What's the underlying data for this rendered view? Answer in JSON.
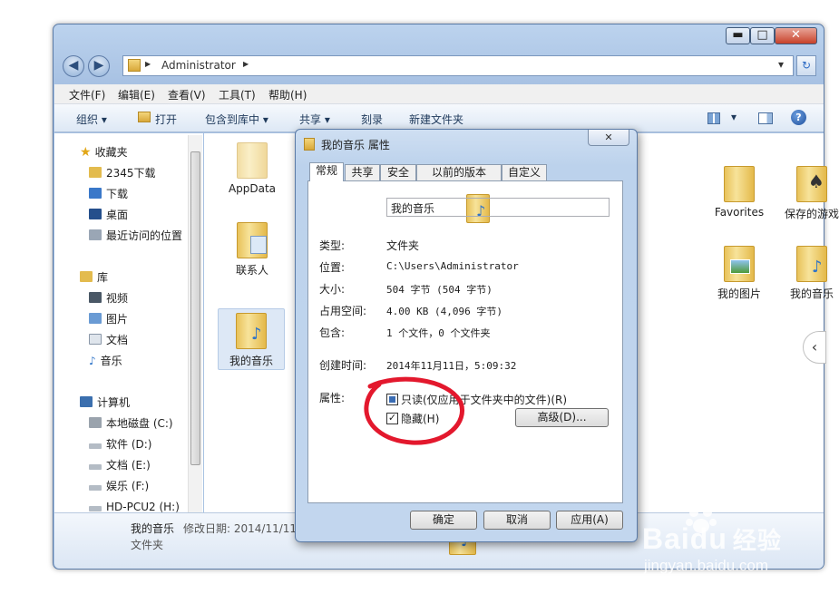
{
  "window": {
    "min": "▬",
    "max": "□",
    "close": "✕",
    "back": "◀",
    "forward": "▶",
    "breadcrumb": "Administrator",
    "breadcrumb_arrow": "▶",
    "dropdown": "▾",
    "refresh": "↻"
  },
  "menu": [
    "文件(F)",
    "编辑(E)",
    "查看(V)",
    "工具(T)",
    "帮助(H)"
  ],
  "toolbar": {
    "organize": "组织 ▾",
    "open": "打开",
    "include": "包含到库中 ▾",
    "share": "共享 ▾",
    "burn": "刻录",
    "new_folder": "新建文件夹",
    "help": "?"
  },
  "nav": {
    "favorites": "收藏夹",
    "fav_items": [
      "2345下载",
      "下载",
      "桌面",
      "最近访问的位置"
    ],
    "library": "库",
    "lib_items": [
      "视频",
      "图片",
      "文档",
      "音乐"
    ],
    "computer": "计算机",
    "drives": [
      "本地磁盘 (C:)",
      "软件 (D:)",
      "文档 (E:)",
      "娱乐 (F:)",
      "HD-PCU2 (H:)"
    ]
  },
  "content": {
    "items": [
      "AppData",
      "联系人",
      "我的音乐",
      "Favorites",
      "保存的游戏",
      "我的图片",
      "我的音乐"
    ]
  },
  "details": {
    "name": "我的音乐",
    "modified": "修改日期: 2014/11/11",
    "type": "文件夹"
  },
  "dialog": {
    "title": "我的音乐 属性",
    "tabs": [
      "常规",
      "共享",
      "安全",
      "以前的版本",
      "自定义"
    ],
    "name_value": "我的音乐",
    "rows": [
      {
        "label": "类型:",
        "value": "文件夹"
      },
      {
        "label": "位置:",
        "value": "C:\\Users\\Administrator"
      },
      {
        "label": "大小:",
        "value": "504 字节 (504 字节)"
      },
      {
        "label": "占用空间:",
        "value": "4.00 KB (4,096 字节)"
      },
      {
        "label": "包含:",
        "value": "1 个文件，0 个文件夹"
      }
    ],
    "created_label": "创建时间:",
    "created_value": "2014年11月11日，5:09:32",
    "attr_label": "属性:",
    "readonly": "只读(仅应用于文件夹中的文件)(R)",
    "hidden": "隐藏(H)",
    "advanced": "高级(D)...",
    "ok": "确定",
    "cancel": "取消",
    "apply": "应用(A)",
    "close": "✕"
  },
  "watermark": {
    "brand": "Bai",
    "brand2": "du",
    "brand3": "经验",
    "url": "jingyan.baidu.com"
  },
  "colors": {
    "annotation_red": "#e3182d",
    "folder_gold": "#e8c25a",
    "accent_blue": "#2d6bc4"
  }
}
